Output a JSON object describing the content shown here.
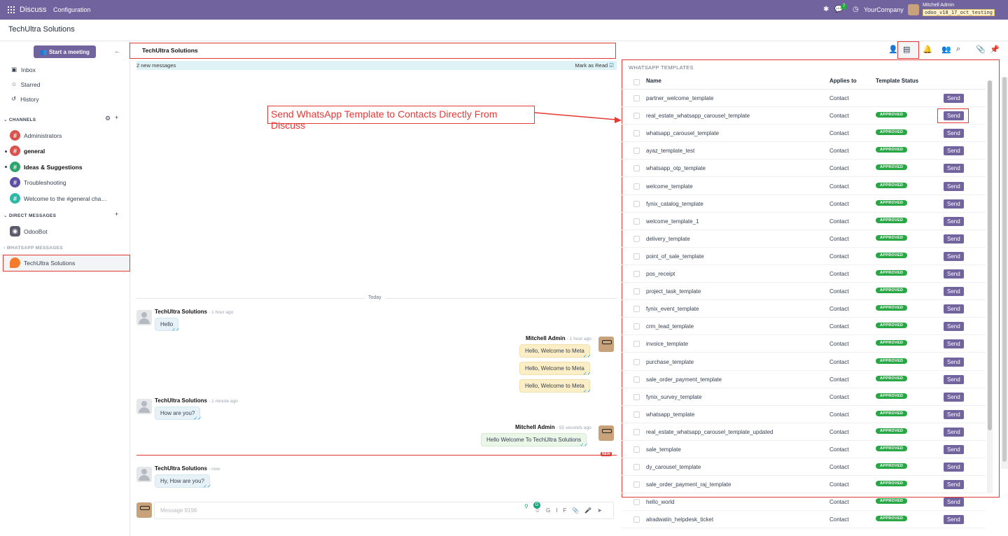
{
  "topbar": {
    "app": "Discuss",
    "menu": "Configuration",
    "badge": "7",
    "company": "YourCompany",
    "user": "Mitchell Admin",
    "db": "odoo_v18_17_oct_testing"
  },
  "titlebar": {
    "title": "TechUltra Solutions"
  },
  "sidebar": {
    "start_meeting": "Start a meeting",
    "nav": [
      {
        "label": "Inbox"
      },
      {
        "label": "Starred"
      },
      {
        "label": "History"
      }
    ],
    "channels_header": "CHANNELS",
    "channels": [
      {
        "label": "Administrators",
        "color": "#d9534f",
        "bold": false
      },
      {
        "label": "general",
        "color": "#d9534f",
        "bold": true
      },
      {
        "label": "Ideas & Suggestions",
        "color": "#2ea36b",
        "bold": true
      },
      {
        "label": "Troubleshooting",
        "color": "#5e4fa2",
        "bold": false
      },
      {
        "label": "Welcome to the #general cha…",
        "color": "#2eb8a6",
        "bold": false
      }
    ],
    "dm_header": "DIRECT MESSAGES",
    "dms": [
      {
        "label": "OdooBot"
      }
    ],
    "wa_header": "WHATSAPP MESSAGES",
    "wa": [
      {
        "label": "TechUltra Solutions"
      }
    ]
  },
  "chat": {
    "header": "TechUltra Solutions",
    "new_messages": "2 new messages",
    "mark_read": "Mark as Read",
    "today": "Today",
    "new_tag": "NEW",
    "messages": [
      {
        "author": "TechUltra Solutions",
        "time": "- 1 hour ago",
        "text": "Hello"
      },
      {
        "author": "Mitchell Admin",
        "time": "- 1 hour ago",
        "texts": [
          "Hello, Welcome to Meta",
          "Hello, Welcome to Meta",
          "Hello, Welcome to Meta"
        ]
      },
      {
        "author": "TechUltra Solutions",
        "time": "- 1 minute ago",
        "text": "How are you?"
      },
      {
        "author": "Mitchell Admin",
        "time": "- 55 seconds ago",
        "text": "Hello Welcome To TechUltra Solutions"
      },
      {
        "author": "TechUltra Solutions",
        "time": "- now",
        "text": "Hy, How are you?"
      }
    ],
    "composer_placeholder": "Message 9196"
  },
  "callout": "Send WhatsApp Template to Contacts Directly From Discuss",
  "panel": {
    "title": "WHATSAPP TEMPLATES",
    "cols": {
      "name": "Name",
      "applies": "Applies to",
      "status": "Template Status"
    },
    "rows": [
      {
        "name": "partner_welcome_template",
        "applies": "Contact",
        "status": "",
        "send": "Send"
      },
      {
        "name": "real_estate_whatsapp_carousel_template",
        "applies": "Contact",
        "status": "APPROVED",
        "send": "Send"
      },
      {
        "name": "whatsapp_carousel_template",
        "applies": "Contact",
        "status": "APPROVED",
        "send": "Send"
      },
      {
        "name": "ayaz_template_test",
        "applies": "Contact",
        "status": "APPROVED",
        "send": "Send"
      },
      {
        "name": "whatsapp_otp_template",
        "applies": "Contact",
        "status": "APPROVED",
        "send": "Send"
      },
      {
        "name": "welcome_template",
        "applies": "Contact",
        "status": "APPROVED",
        "send": "Send"
      },
      {
        "name": "fynix_catalog_template",
        "applies": "Contact",
        "status": "APPROVED",
        "send": "Send"
      },
      {
        "name": "welcome_template_1",
        "applies": "Contact",
        "status": "APPROVED",
        "send": "Send"
      },
      {
        "name": "delivery_template",
        "applies": "Contact",
        "status": "APPROVED",
        "send": "Send"
      },
      {
        "name": "point_of_sale_template",
        "applies": "Contact",
        "status": "APPROVED",
        "send": "Send"
      },
      {
        "name": "pos_receipt",
        "applies": "Contact",
        "status": "APPROVED",
        "send": "Send"
      },
      {
        "name": "project_task_template",
        "applies": "Contact",
        "status": "APPROVED",
        "send": "Send"
      },
      {
        "name": "fynix_event_template",
        "applies": "Contact",
        "status": "APPROVED",
        "send": "Send"
      },
      {
        "name": "crm_lead_template",
        "applies": "Contact",
        "status": "APPROVED",
        "send": "Send"
      },
      {
        "name": "invoice_template",
        "applies": "Contact",
        "status": "APPROVED",
        "send": "Send"
      },
      {
        "name": "purchase_template",
        "applies": "Contact",
        "status": "APPROVED",
        "send": "Send"
      },
      {
        "name": "sale_order_payment_template",
        "applies": "Contact",
        "status": "APPROVED",
        "send": "Send"
      },
      {
        "name": "fynix_survey_template",
        "applies": "Contact",
        "status": "APPROVED",
        "send": "Send"
      },
      {
        "name": "whatsapp_template",
        "applies": "Contact",
        "status": "APPROVED",
        "send": "Send"
      },
      {
        "name": "real_estate_whatsapp_carousel_template_updated",
        "applies": "Contact",
        "status": "APPROVED",
        "send": "Send"
      },
      {
        "name": "sale_template",
        "applies": "Contact",
        "status": "APPROVED",
        "send": "Send"
      },
      {
        "name": "dy_carousel_template",
        "applies": "Contact",
        "status": "APPROVED",
        "send": "Send"
      },
      {
        "name": "sale_order_payment_raj_template",
        "applies": "Contact",
        "status": "APPROVED",
        "send": "Send"
      },
      {
        "name": "hello_world",
        "applies": "Contact",
        "status": "APPROVED",
        "send": "Send"
      },
      {
        "name": "alradwatin_helpdesk_ticket",
        "applies": "Contact",
        "status": "APPROVED",
        "send": "Send"
      }
    ]
  }
}
